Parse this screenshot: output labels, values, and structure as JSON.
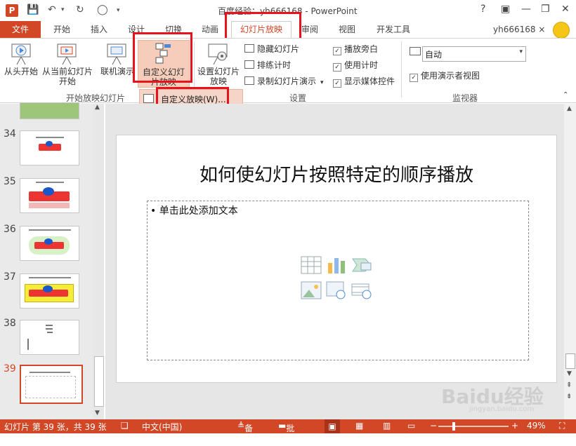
{
  "titlebar": {
    "title": "百度经验：yh666168 - PowerPoint",
    "help": "?",
    "minimize": "—",
    "restore": "❐",
    "close": "✕"
  },
  "tabs": {
    "file": "文件",
    "items": [
      "开始",
      "插入",
      "设计",
      "切换",
      "动画",
      "幻灯片放映",
      "审阅",
      "视图",
      "开发工具"
    ],
    "account": "yh666168 ×"
  },
  "ribbon": {
    "from_beginning": "从头开始",
    "from_current": "从当前幻灯片开始",
    "online": "联机演示",
    "custom_show": "自定义幻灯片放映",
    "setup_show": "设置幻灯片放映",
    "hide_slide": "隐藏幻灯片",
    "rehearse": "排练计时",
    "record": "录制幻灯片演示",
    "play_narration": "播放旁白",
    "use_timings": "使用计时",
    "show_media": "显示媒体控件",
    "monitor_value": "自动",
    "presenter_view": "使用演示者视图",
    "group_start": "开始放映幻灯片",
    "group_setup": "设置",
    "group_monitor": "监视器"
  },
  "dropdown": {
    "item": "自定义放映(W)..."
  },
  "thumbnails": [
    {
      "num": "34",
      "kind": "baidu-small"
    },
    {
      "num": "35",
      "kind": "baidu-big"
    },
    {
      "num": "36",
      "kind": "baidu-glow"
    },
    {
      "num": "37",
      "kind": "baidu-yellow"
    },
    {
      "num": "38",
      "kind": "text"
    },
    {
      "num": "39",
      "kind": "selected"
    }
  ],
  "slide": {
    "title": "如何使幻灯片按照特定的顺序播放",
    "placeholder": "• 单击此处添加文本"
  },
  "status": {
    "slide_info": "幻灯片 第 39 张，共 39 张",
    "language": "中文(中国)",
    "notes": "备注",
    "comments": "批注",
    "zoom": "49%",
    "watermark": "Baidu经验",
    "watermark_url": "jingyan.baidu.com"
  },
  "colors": {
    "accent": "#D24726",
    "highlight_box": "#E8121C"
  }
}
